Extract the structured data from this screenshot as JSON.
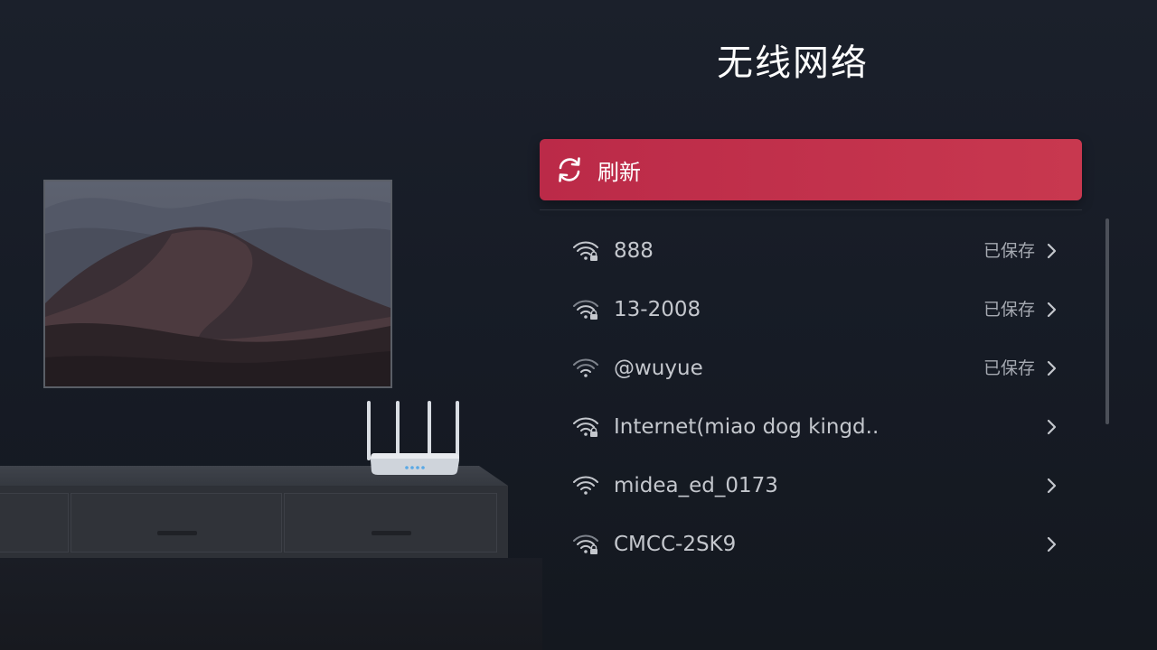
{
  "header": {
    "title": "无线网络"
  },
  "refresh": {
    "label": "刷新",
    "icon": "refresh-icon"
  },
  "networks": [
    {
      "ssid": "888",
      "status": "已保存",
      "secured": true,
      "signal_icon": "wifi-locked-icon"
    },
    {
      "ssid": "13-2008",
      "status": "已保存",
      "secured": true,
      "signal_icon": "wifi-locked-icon"
    },
    {
      "ssid": "@wuyue",
      "status": "已保存",
      "secured": false,
      "signal_icon": "wifi-icon"
    },
    {
      "ssid": "Internet(miao dog kingd..",
      "status": "",
      "secured": true,
      "signal_icon": "wifi-locked-icon"
    },
    {
      "ssid": "midea_ed_0173",
      "status": "",
      "secured": false,
      "signal_icon": "wifi-icon"
    },
    {
      "ssid": "CMCC-2SK9",
      "status": "",
      "secured": true,
      "signal_icon": "wifi-locked-icon"
    }
  ],
  "colors": {
    "background": "#1b202b",
    "accent": "#c8384f",
    "text_primary": "#ffffff",
    "text_secondary": "#c4c7cd"
  }
}
